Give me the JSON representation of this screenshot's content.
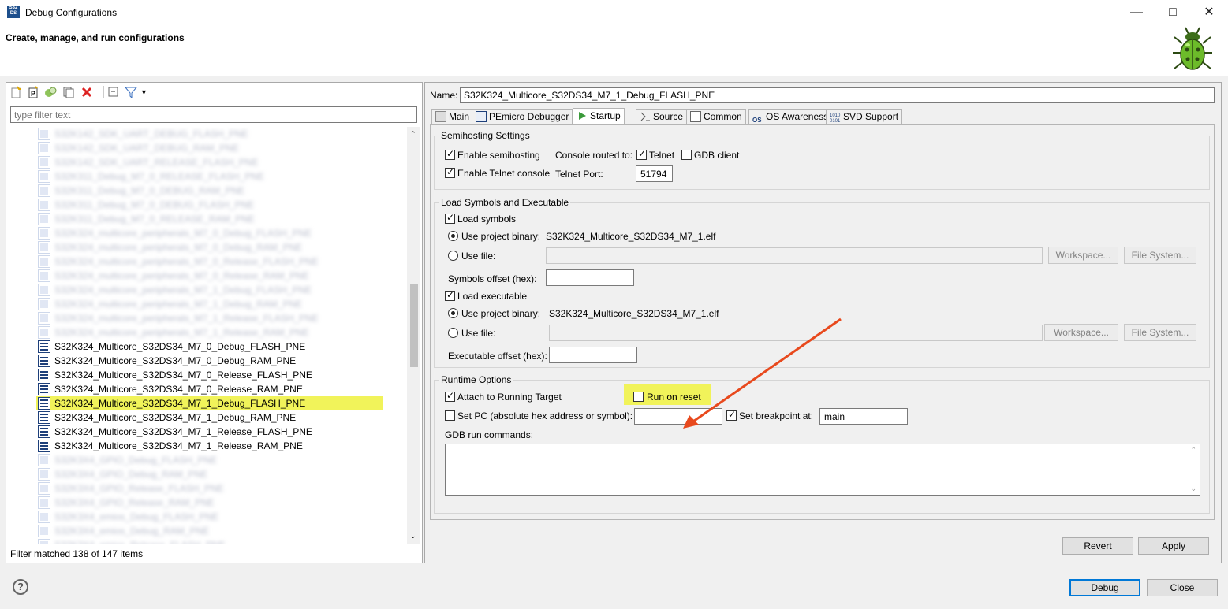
{
  "window": {
    "title": "Debug Configurations",
    "app_icon_text": "S32\nDS"
  },
  "header": {
    "title": "Create, manage, and run configurations"
  },
  "left": {
    "filter_placeholder": "type filter text",
    "tree_items": [
      {
        "label": "S32K142_SDK_UART_DEBUG_FLASH_PNE",
        "blurred": true
      },
      {
        "label": "S32K142_SDK_UART_DEBUG_RAM_PNE",
        "blurred": true
      },
      {
        "label": "S32K142_SDK_UART_RELEASE_FLASH_PNE",
        "blurred": true
      },
      {
        "label": "S32K311_Debug_M7_0_RELEASE_FLASH_PNE",
        "blurred": true
      },
      {
        "label": "S32K311_Debug_M7_0_DEBUG_RAM_PNE",
        "blurred": true
      },
      {
        "label": "S32K311_Debug_M7_0_DEBUG_FLASH_PNE",
        "blurred": true
      },
      {
        "label": "S32K311_Debug_M7_0_RELEASE_RAM_PNE",
        "blurred": true
      },
      {
        "label": "S32K324_multicore_peripherals_M7_0_Debug_FLASH_PNE",
        "blurred": true
      },
      {
        "label": "S32K324_multicore_peripherals_M7_0_Debug_RAM_PNE",
        "blurred": true
      },
      {
        "label": "S32K324_multicore_peripherals_M7_0_Release_FLASH_PNE",
        "blurred": true
      },
      {
        "label": "S32K324_multicore_peripherals_M7_0_Release_RAM_PNE",
        "blurred": true
      },
      {
        "label": "S32K324_multicore_peripherals_M7_1_Debug_FLASH_PNE",
        "blurred": true
      },
      {
        "label": "S32K324_multicore_peripherals_M7_1_Debug_RAM_PNE",
        "blurred": true
      },
      {
        "label": "S32K324_multicore_peripherals_M7_1_Release_FLASH_PNE",
        "blurred": true
      },
      {
        "label": "S32K324_multicore_peripherals_M7_1_Release_RAM_PNE",
        "blurred": true
      },
      {
        "label": "S32K324_Multicore_S32DS34_M7_0_Debug_FLASH_PNE",
        "blurred": false
      },
      {
        "label": "S32K324_Multicore_S32DS34_M7_0_Debug_RAM_PNE",
        "blurred": false
      },
      {
        "label": "S32K324_Multicore_S32DS34_M7_0_Release_FLASH_PNE",
        "blurred": false
      },
      {
        "label": "S32K324_Multicore_S32DS34_M7_0_Release_RAM_PNE",
        "blurred": false
      },
      {
        "label": "S32K324_Multicore_S32DS34_M7_1_Debug_FLASH_PNE",
        "blurred": false,
        "selected": true
      },
      {
        "label": "S32K324_Multicore_S32DS34_M7_1_Debug_RAM_PNE",
        "blurred": false
      },
      {
        "label": "S32K324_Multicore_S32DS34_M7_1_Release_FLASH_PNE",
        "blurred": false
      },
      {
        "label": "S32K324_Multicore_S32DS34_M7_1_Release_RAM_PNE",
        "blurred": false
      },
      {
        "label": "S32K3X4_GPIO_Debug_FLASH_PNE",
        "blurred": true
      },
      {
        "label": "S32K3X4_GPIO_Debug_RAM_PNE",
        "blurred": true
      },
      {
        "label": "S32K3X4_GPIO_Release_FLASH_PNE",
        "blurred": true
      },
      {
        "label": "S32K3X4_GPIO_Release_RAM_PNE",
        "blurred": true
      },
      {
        "label": "S32K3X4_emios_Debug_FLASH_PNE",
        "blurred": true
      },
      {
        "label": "S32K3X4_emios_Debug_RAM_PNE",
        "blurred": true
      },
      {
        "label": "S32K3X4_emios_Release_FLASH_PNE",
        "blurred": true
      }
    ],
    "status": "Filter matched 138 of 147 items"
  },
  "right": {
    "name_label": "Name:",
    "name_value": "S32K324_Multicore_S32DS34_M7_1_Debug_FLASH_PNE",
    "tabs": [
      "Main",
      "PEmicro Debugger",
      "Startup",
      "Source",
      "Common",
      "OS Awareness",
      "SVD Support"
    ],
    "active_tab": "Startup",
    "semihosting": {
      "title": "Semihosting Settings",
      "enable_semihosting": "Enable semihosting",
      "enable_telnet": "Enable Telnet console",
      "console_routed": "Console routed to:",
      "telnet": "Telnet",
      "gdb_client": "GDB client",
      "telnet_port_label": "Telnet Port:",
      "telnet_port": "51794"
    },
    "load": {
      "title": "Load Symbols and Executable",
      "load_symbols": "Load symbols",
      "use_project_binary": "Use project binary:",
      "symbols_binary": "S32K324_Multicore_S32DS34_M7_1.elf",
      "use_file": "Use file:",
      "workspace": "Workspace...",
      "file_system": "File System...",
      "symbols_offset": "Symbols offset (hex):",
      "load_executable": "Load executable",
      "exec_binary": "S32K324_Multicore_S32DS34_M7_1.elf",
      "exec_offset": "Executable offset (hex):"
    },
    "runtime": {
      "title": "Runtime Options",
      "attach": "Attach to Running Target",
      "run_on_reset": "Run on reset",
      "set_pc": "Set PC (absolute hex address or symbol):",
      "set_breakpoint": "Set breakpoint at:",
      "breakpoint_value": "main",
      "gdb_commands": "GDB run commands:"
    },
    "revert": "Revert",
    "apply": "Apply"
  },
  "footer": {
    "debug": "Debug",
    "close": "Close"
  },
  "colors": {
    "highlight": "#f1f35a",
    "arrow": "#e8491d",
    "accent": "#0078d7"
  }
}
